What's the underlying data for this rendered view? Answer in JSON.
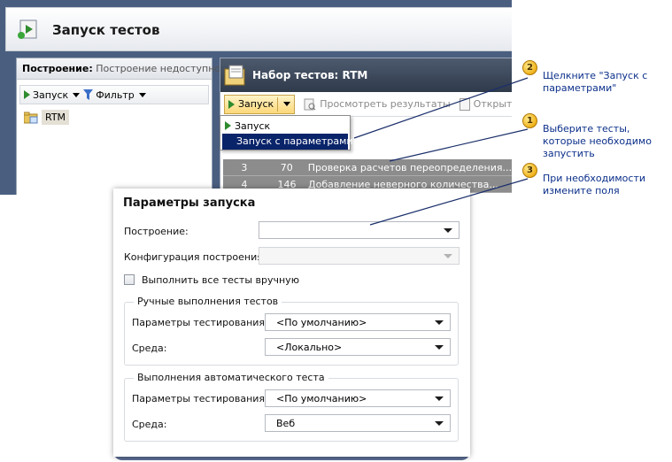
{
  "window": {
    "title": "Запуск тестов"
  },
  "left_pane": {
    "header_label": "Построение:",
    "header_value": "Построение недоступно",
    "toolbar": {
      "run_label": "Запуск",
      "filter_label": "Фильтр"
    },
    "tree": [
      {
        "label": "RTM"
      }
    ]
  },
  "right_pane": {
    "title": "Набор тестов: RTM",
    "toolbar": {
      "run_label": "Запуск",
      "view_results_label": "Просмотреть результаты",
      "open_test_label": "Открыть тест"
    },
    "run_menu": {
      "items": [
        {
          "label": "Запуск"
        },
        {
          "label": "Запуск с параметрами"
        }
      ]
    },
    "tests": [
      {
        "order": "3",
        "id": "70",
        "title": "Проверка расчетов переопределения..."
      },
      {
        "order": "4",
        "id": "146",
        "title": "Добавление неверного количества..."
      }
    ]
  },
  "callouts": [
    {
      "number": "2",
      "text": "Щелкните \"Запуск с параметрами\""
    },
    {
      "number": "1",
      "text": "Выберите тесты, которые необходимо запустить"
    },
    {
      "number": "3",
      "text": "При необходимости измените поля"
    }
  ],
  "dialog": {
    "title": "Параметры запуска",
    "build_label": "Построение:",
    "build_value": "",
    "build_config_label": "Конфигурация построения:",
    "build_config_value": "",
    "manual_checkbox_label": "Выполнить все тесты вручную",
    "manual_checked": false,
    "manual_group": {
      "title": "Ручные выполнения тестов",
      "settings_label": "Параметры тестирования:",
      "settings_value": "<По умолчанию>",
      "environment_label": "Среда:",
      "environment_value": "<Локально>"
    },
    "auto_group": {
      "title": "Выполнения автоматического теста",
      "settings_label": "Параметры тестирования:",
      "settings_value": "<По умолчанию>",
      "environment_label": "Среда:",
      "environment_value": "Веб"
    }
  },
  "colors": {
    "callout_text": "#0b2f8a",
    "menu_highlight": "#0a246a",
    "badge": "#f0b21b",
    "window_frame": "#4a5f80"
  }
}
